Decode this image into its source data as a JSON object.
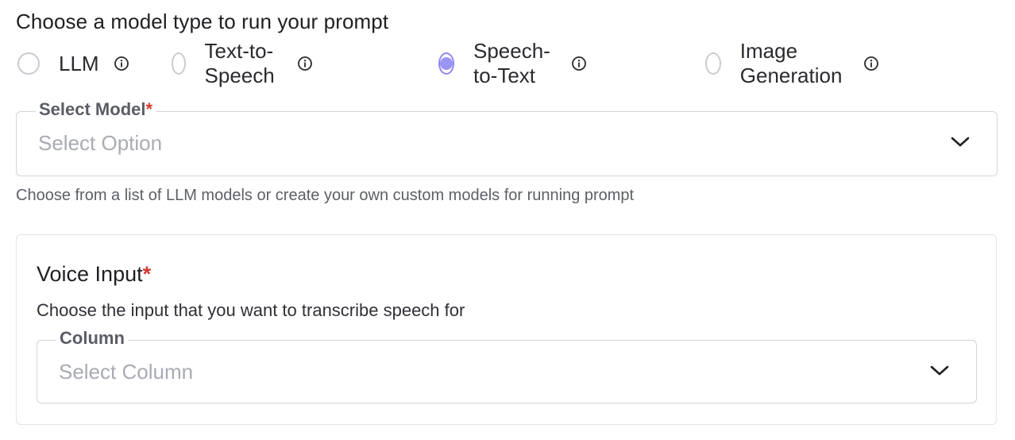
{
  "heading": "Choose a model type to run your prompt",
  "model_types": [
    {
      "label": "LLM",
      "checked": false,
      "info_icon": "info-icon"
    },
    {
      "label": "Text-to-Speech",
      "checked": false,
      "info_icon": "info-icon"
    },
    {
      "label": "Speech-to-Text",
      "checked": true,
      "info_icon": "info-icon"
    },
    {
      "label": "Image Generation",
      "checked": false,
      "info_icon": "info-icon"
    }
  ],
  "select_model": {
    "label": "Select Model",
    "required_mark": "*",
    "placeholder": "Select Option",
    "icon": "chevron-down-icon",
    "helper": "Choose from a list of LLM models or create your own custom models for running prompt"
  },
  "voice_input": {
    "title": "Voice Input",
    "required_mark": "*",
    "description": "Choose the input that you want to transcribe speech for",
    "column": {
      "label": "Column",
      "placeholder": "Select Column",
      "icon": "chevron-down-icon"
    }
  },
  "colors": {
    "accent": "#9d95f5",
    "required": "#d23a2f",
    "border": "#d3d5db",
    "placeholder": "#a9abb3"
  }
}
